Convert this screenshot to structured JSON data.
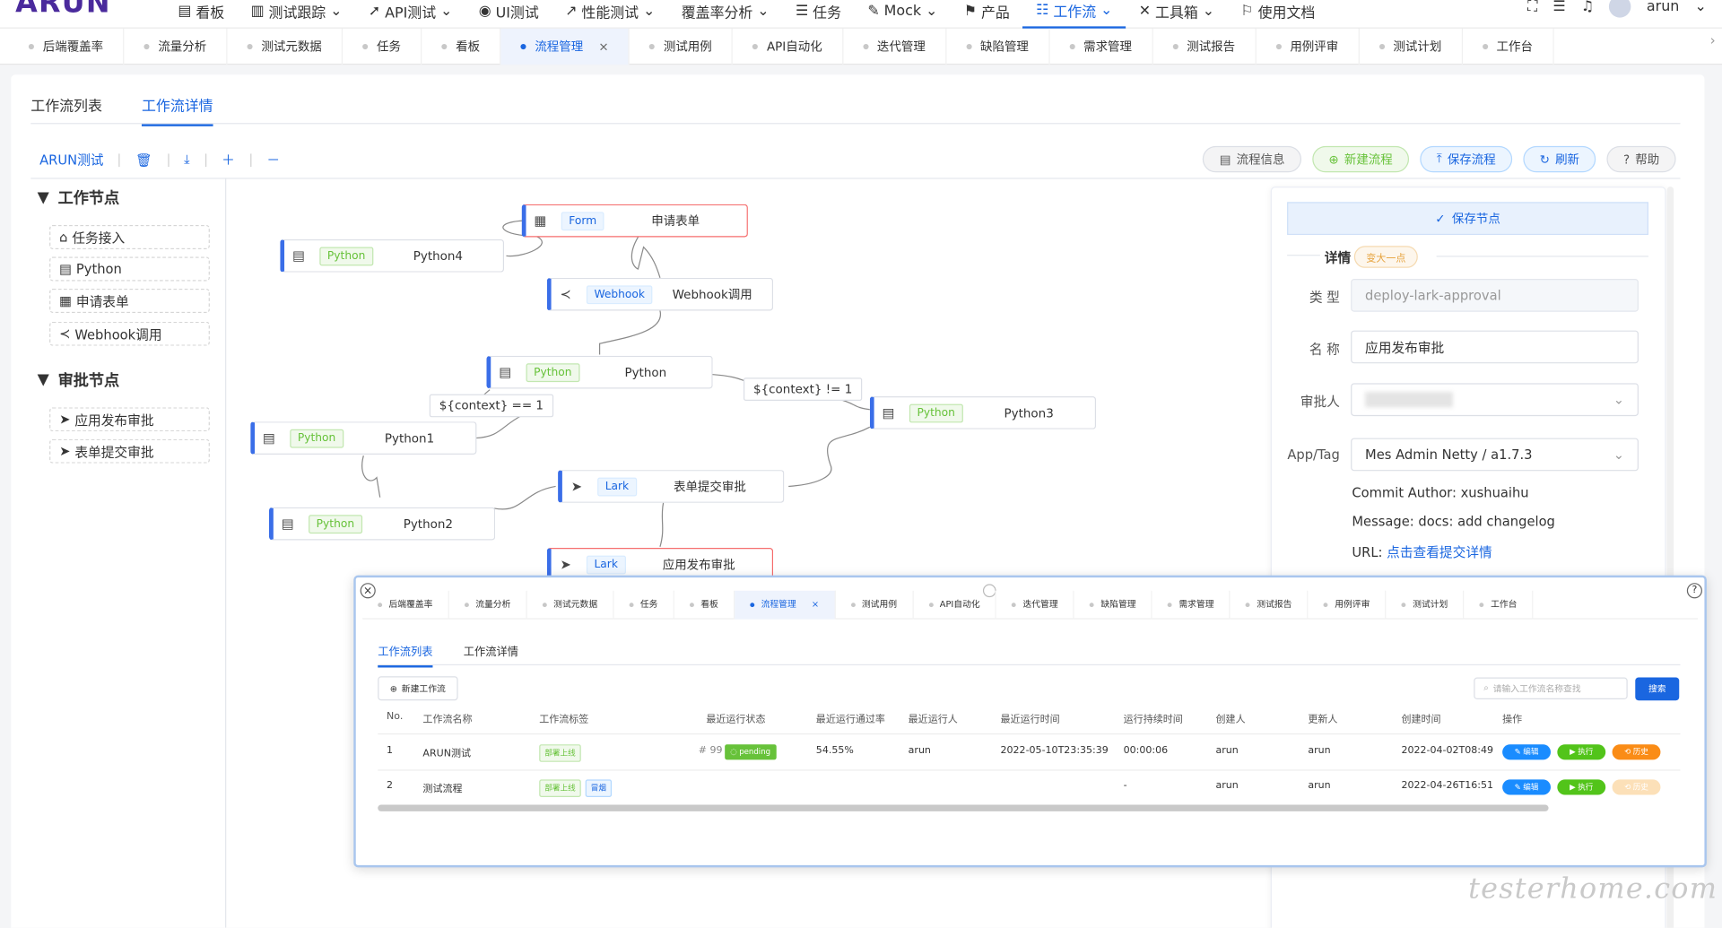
{
  "header": {
    "logo": "ARUN",
    "nav": [
      {
        "icon": "dashboard-icon",
        "label": "看板",
        "caret": false
      },
      {
        "icon": "tracking-icon",
        "label": "测试跟踪",
        "caret": true
      },
      {
        "icon": "api-icon",
        "label": "API测试",
        "caret": true
      },
      {
        "icon": "ui-test-icon",
        "label": "UI测试",
        "caret": false
      },
      {
        "icon": "performance-icon",
        "label": "性能测试",
        "caret": true
      },
      {
        "icon": "",
        "label": "覆盖率分析",
        "caret": true
      },
      {
        "icon": "task-icon",
        "label": "任务",
        "caret": false
      },
      {
        "icon": "mock-icon",
        "label": "Mock",
        "caret": true
      },
      {
        "icon": "product-icon",
        "label": "产品",
        "caret": false
      },
      {
        "icon": "workflow-icon",
        "label": "工作流",
        "caret": true
      },
      {
        "icon": "toolbox-icon",
        "label": "工具箱",
        "caret": true
      },
      {
        "icon": "docs-icon",
        "label": "使用文档",
        "caret": false
      }
    ],
    "user": "arun"
  },
  "tabs": [
    {
      "label": "后端覆盖率",
      "active": false
    },
    {
      "label": "流量分析",
      "active": false
    },
    {
      "label": "测试元数据",
      "active": false
    },
    {
      "label": "任务",
      "active": false
    },
    {
      "label": "看板",
      "active": false
    },
    {
      "label": "流程管理",
      "active": true
    },
    {
      "label": "测试用例",
      "active": false
    },
    {
      "label": "API自动化",
      "active": false
    },
    {
      "label": "迭代管理",
      "active": false
    },
    {
      "label": "缺陷管理",
      "active": false
    },
    {
      "label": "需求管理",
      "active": false
    },
    {
      "label": "测试报告",
      "active": false
    },
    {
      "label": "用例评审",
      "active": false
    },
    {
      "label": "测试计划",
      "active": false
    },
    {
      "label": "工作台",
      "active": false
    }
  ],
  "subtabs": {
    "list": "工作流列表",
    "detail": "工作流详情"
  },
  "toolbar": {
    "flow_name": "ARUN测试"
  },
  "actions": {
    "info": "流程信息",
    "new": "新建流程",
    "save": "保存流程",
    "refresh": "刷新",
    "help": "帮助"
  },
  "palette": {
    "work_title": "工作节点",
    "work_items": [
      {
        "icon": "task-access-icon",
        "label": "任务接入"
      },
      {
        "icon": "python-doc-icon",
        "label": "Python"
      },
      {
        "icon": "form-grid-icon",
        "label": "申请表单"
      },
      {
        "icon": "share-icon",
        "label": "Webhook调用"
      }
    ],
    "approve_title": "审批节点",
    "approve_items": [
      {
        "icon": "send-icon",
        "label": "应用发布审批"
      },
      {
        "icon": "send-icon",
        "label": "表单提交审批"
      }
    ]
  },
  "flow": {
    "nodes": {
      "form": {
        "tag": "Form",
        "name": "申请表单"
      },
      "python4": {
        "tag": "Python",
        "name": "Python4"
      },
      "webhook": {
        "tag": "Webhook",
        "name": "Webhook调用"
      },
      "python": {
        "tag": "Python",
        "name": "Python"
      },
      "python3": {
        "tag": "Python",
        "name": "Python3"
      },
      "python1": {
        "tag": "Python",
        "name": "Python1"
      },
      "lark1": {
        "tag": "Lark",
        "name": "表单提交审批"
      },
      "python2": {
        "tag": "Python",
        "name": "Python2"
      },
      "lark2": {
        "tag": "Lark",
        "name": "应用发布审批"
      }
    },
    "cond_eq": "${context} == 1",
    "cond_neq": "${context} != 1"
  },
  "detail": {
    "save_node": "保存节点",
    "section": "详情",
    "badge": "变大一点",
    "type_label": "类 型",
    "type_value": "deploy-lark-approval",
    "name_label": "名 称",
    "name_value": "应用发布审批",
    "approver_label": "审批人",
    "approver_value": "",
    "apptag_label": "App/Tag",
    "apptag_value": "Mes Admin Netty / a1.7.3",
    "commit_author_label": "Commit Author:",
    "commit_author": "xushuaihu",
    "message_label": "Message:",
    "message": "docs: add changelog",
    "url_label": "URL:",
    "url_text": "点击查看提交详情"
  },
  "overlay": {
    "tabs": [
      "后端覆盖率",
      "流量分析",
      "测试元数据",
      "任务",
      "看板",
      "流程管理",
      "测试用例",
      "API自动化",
      "迭代管理",
      "缺陷管理",
      "需求管理",
      "测试报告",
      "用例评审",
      "测试计划",
      "工作台"
    ],
    "active_tab": "流程管理",
    "subtab_list": "工作流列表",
    "subtab_detail": "工作流详情",
    "new_btn": "新建工作流",
    "search_placeholder": "请输入工作流名称查找",
    "search_btn": "搜索",
    "columns": [
      "No.",
      "工作流名称",
      "工作流标签",
      "最近运行状态",
      "最近运行通过率",
      "最近运行人",
      "最近运行时间",
      "运行持续时间",
      "创建人",
      "更新人",
      "创建时间",
      "操作"
    ],
    "rows": [
      {
        "no": "1",
        "name": "ARUN测试",
        "tags": [
          "部署上线"
        ],
        "run_no": "# 99",
        "status": "pending",
        "rate": "54.55%",
        "runner": "arun",
        "run_time": "2022-05-10T23:35:39",
        "duration": "00:00:06",
        "creator": "arun",
        "updater": "arun",
        "created": "2022-04-02T08:49:"
      },
      {
        "no": "2",
        "name": "测试流程",
        "tags": [
          "部署上线",
          "冒烟"
        ],
        "run_no": "",
        "status": "",
        "rate": "",
        "runner": "",
        "run_time": "",
        "duration": "-",
        "creator": "arun",
        "updater": "arun",
        "created": "2022-04-26T16:51:"
      }
    ],
    "op_edit": "编辑",
    "op_run": "执行",
    "op_history": "历史"
  },
  "watermark": "testerhome.com"
}
